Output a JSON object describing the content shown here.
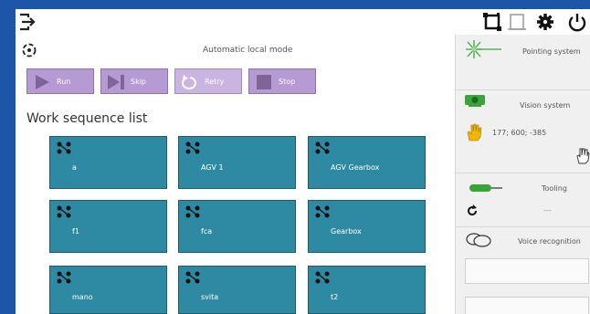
{
  "toolbar": {
    "icons": [
      "exit-icon",
      "robot-frame-icon",
      "window-frame-icon",
      "gear-icon",
      "power-icon"
    ]
  },
  "mode": {
    "title": "Automatic local mode",
    "icon": "target-icon"
  },
  "controls": [
    {
      "label": "Run",
      "icon": "play-icon"
    },
    {
      "label": "Skip",
      "icon": "skip-icon"
    },
    {
      "label": "Retry",
      "icon": "retry-icon"
    },
    {
      "label": "Stop",
      "icon": "stop-icon"
    }
  ],
  "sequence_list": {
    "title": "Work sequence list",
    "items": [
      "a",
      "AGV 1",
      "AGV Gearbox",
      "f1",
      "fca",
      "Gearbox",
      "mano",
      "svita",
      "t2"
    ]
  },
  "side": {
    "pointing": {
      "title": "Pointing system"
    },
    "vision": {
      "title": "Vision system",
      "coords": "177; 600; -385"
    },
    "tooling": {
      "title": "Tooling",
      "value": "---"
    },
    "voice": {
      "title": "Voice recognition"
    }
  },
  "colors": {
    "frame": "#1d55a8",
    "control_button": "#b59ad3",
    "sequence_card": "#2e8aa3"
  }
}
